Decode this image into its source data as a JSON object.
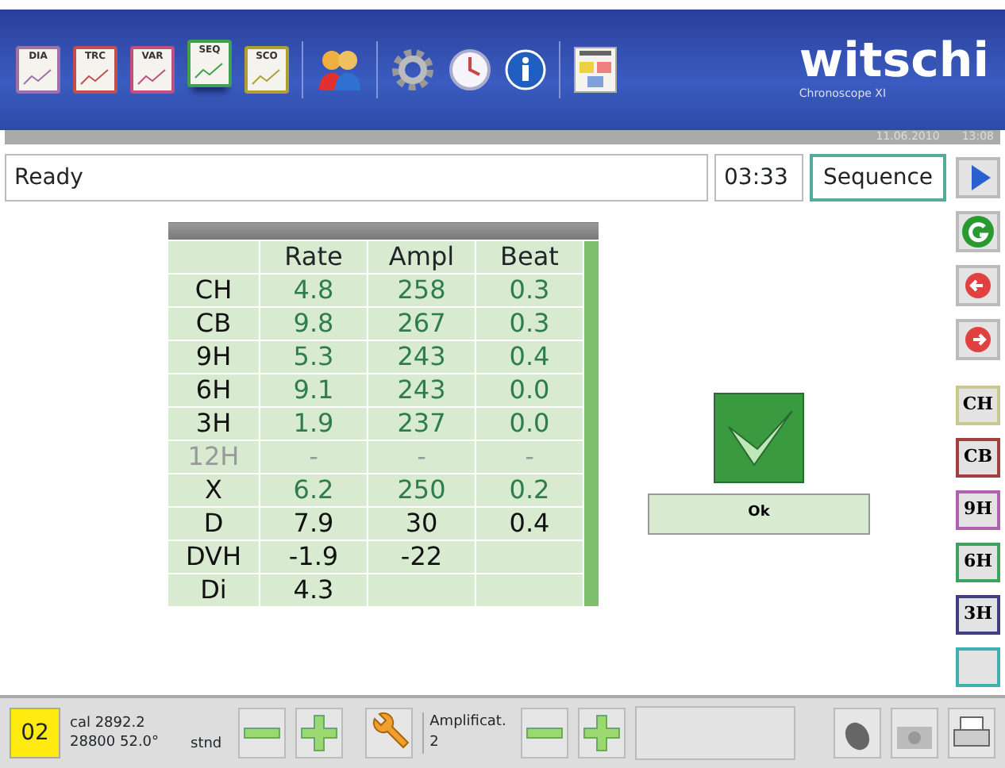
{
  "toolbar": {
    "tools": [
      {
        "kind": "doc",
        "label": "DIA",
        "color": "#a070a8",
        "selected": false
      },
      {
        "kind": "doc",
        "label": "TRC",
        "color": "#c05050",
        "selected": false
      },
      {
        "kind": "doc",
        "label": "VAR",
        "color": "#c05080",
        "selected": false
      },
      {
        "kind": "doc",
        "label": "SEQ",
        "color": "#40a050",
        "selected": true
      },
      {
        "kind": "doc",
        "label": "SCO",
        "color": "#b0a030",
        "selected": false
      },
      {
        "kind": "users"
      },
      {
        "kind": "gear"
      },
      {
        "kind": "clock"
      },
      {
        "kind": "info"
      },
      {
        "kind": "report"
      }
    ],
    "brand": "witschi",
    "product": "Chronoscope XI"
  },
  "info_bar": {
    "date": "11.06.2010",
    "time": "13:08"
  },
  "status": {
    "message": "Ready",
    "timer": "03:33",
    "mode": "Sequence"
  },
  "table": {
    "columns": [
      "Rate",
      "Ampl",
      "Beat"
    ],
    "rows": [
      {
        "label": "CH",
        "kind": "measured",
        "cells": [
          "4.8",
          "258",
          "0.3"
        ]
      },
      {
        "label": "CB",
        "kind": "measured",
        "cells": [
          "9.8",
          "267",
          "0.3"
        ]
      },
      {
        "label": "9H",
        "kind": "measured",
        "cells": [
          "5.3",
          "243",
          "0.4"
        ]
      },
      {
        "label": "6H",
        "kind": "measured",
        "cells": [
          "9.1",
          "243",
          "0.0"
        ]
      },
      {
        "label": "3H",
        "kind": "measured",
        "cells": [
          "1.9",
          "237",
          "0.0"
        ]
      },
      {
        "label": "12H",
        "kind": "pending",
        "cells": [
          "-",
          "-",
          "-"
        ]
      },
      {
        "label": "X",
        "kind": "average",
        "cells": [
          "6.2",
          "250",
          "0.2"
        ]
      },
      {
        "label": "D",
        "kind": "computed",
        "cells": [
          "7.9",
          "30",
          "0.4"
        ]
      },
      {
        "label": "DVH",
        "kind": "computed",
        "cells": [
          "-1.9",
          "-22",
          ""
        ]
      },
      {
        "label": "Di",
        "kind": "computed",
        "cells": [
          "4.3",
          "",
          ""
        ]
      }
    ]
  },
  "result": {
    "passed": true,
    "button": "Ok"
  },
  "side_buttons": [
    {
      "kind": "play"
    },
    {
      "kind": "restart"
    },
    {
      "kind": "back"
    },
    {
      "kind": "forward"
    },
    {
      "kind": "position",
      "label": "CH",
      "color": "#c8c890"
    },
    {
      "kind": "position",
      "label": "CB",
      "color": "#a04040"
    },
    {
      "kind": "position",
      "label": "9H",
      "color": "#b060b0"
    },
    {
      "kind": "position",
      "label": "6H",
      "color": "#40a060"
    },
    {
      "kind": "position",
      "label": "3H",
      "color": "#404080"
    },
    {
      "kind": "position",
      "color": "#40b0b0"
    }
  ],
  "bottom": {
    "channel": "02",
    "calibre": "cal 2892.2",
    "frequency": "28800 52.0°",
    "mode": "stnd",
    "amp_label": "Amplificat.",
    "amp_value": "2"
  }
}
